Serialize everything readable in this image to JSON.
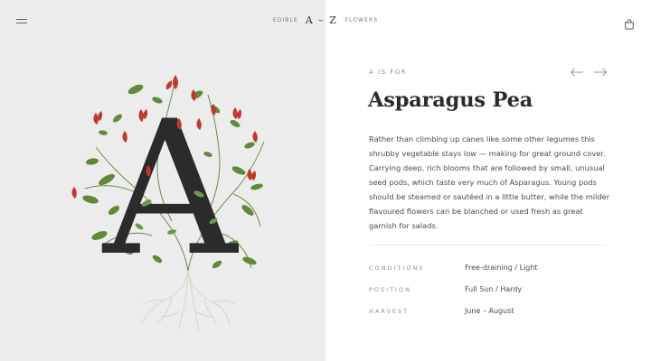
{
  "header": {
    "brand_left": "EDIBLE",
    "brand_mark": "A – Z",
    "brand_right": "FLOWERS",
    "menu_icon": "hamburger-icon",
    "bag_icon": "shopping-bag-icon"
  },
  "hero": {
    "letter": "A",
    "letter_color": "#2b2b2b",
    "flower_color": "#c0392b",
    "leaf_color": "#5e8a3a",
    "root_color": "#d9cfbd",
    "background": "#ececec"
  },
  "entry": {
    "eyebrow": "A IS FOR",
    "title": "Asparagus Pea",
    "description": "Rather than climbing up canes like some other legumes this shrubby vegetable stays low — making for great ground cover. Carrying deep, rich blooms that are followed by small, unusual seed pods, which taste very much of Asparagus. Young pods should be steamed or sautéed in a little butter, while the milder flavoured flowers can be blanched or used fresh as great garnish for salads.",
    "prev_icon": "arrow-left-icon",
    "next_icon": "arrow-right-icon"
  },
  "specs": [
    {
      "label": "CONDITIONS",
      "value": "Free-draining / Light"
    },
    {
      "label": "POSITION",
      "value": "Full Sun / Hardy"
    },
    {
      "label": "HARVEST",
      "value": "June – August"
    }
  ]
}
